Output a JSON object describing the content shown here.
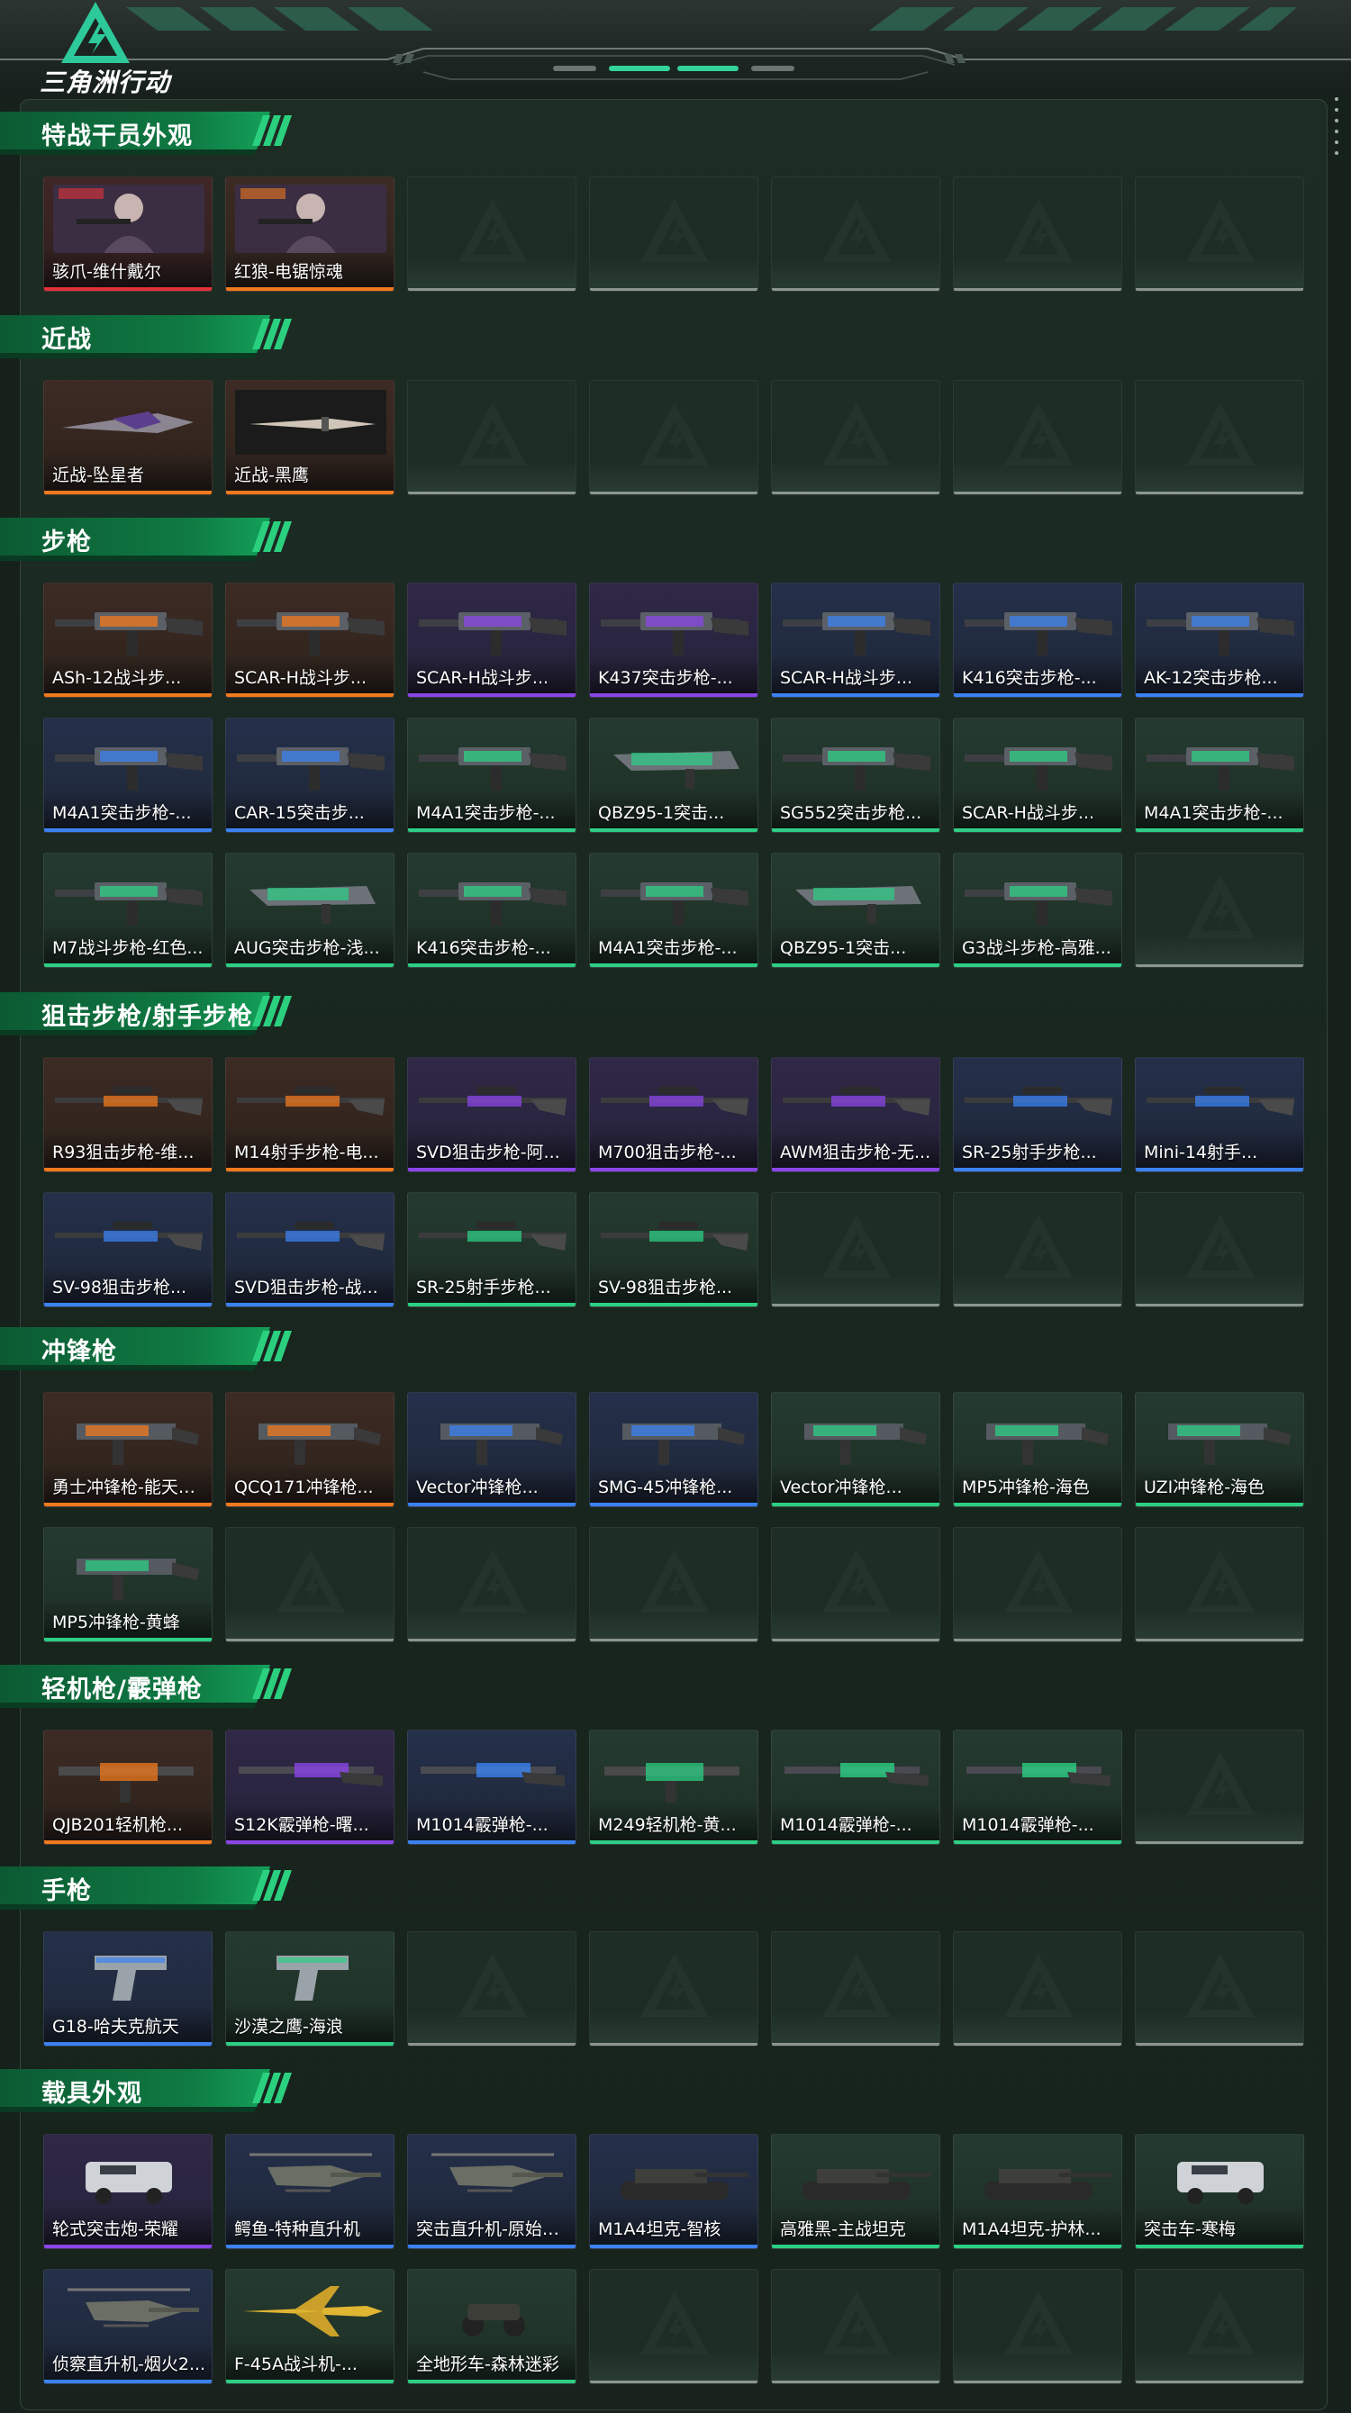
{
  "header": {
    "game_logo_text": "三角洲行动",
    "logo_icon": "delta-triangle-icon",
    "page_indicator_count": 4,
    "page_indicator_active": [
      1,
      2
    ]
  },
  "colors": {
    "orange": "#f07a1e",
    "purple": "#8a45e6",
    "blue": "#3b82f0",
    "green": "#2ccf84",
    "red": "#e2323a",
    "accent": "#33d39a"
  },
  "sections": [
    {
      "title": "特战干员外观",
      "rows": [
        [
          {
            "label": "骇爪-维什戴尔",
            "rarity": "red",
            "icon": "operator-portrait-icon"
          },
          {
            "label": "红狼-电锯惊魂",
            "rarity": "orange",
            "icon": "operator-portrait-icon"
          },
          null,
          null,
          null,
          null,
          null
        ]
      ]
    },
    {
      "title": "近战",
      "rows": [
        [
          {
            "label": "近战-坠星者",
            "rarity": "orange",
            "icon": "blade-icon"
          },
          {
            "label": "近战-黑鹰",
            "rarity": "orange",
            "icon": "knife-icon"
          },
          null,
          null,
          null,
          null,
          null
        ]
      ]
    },
    {
      "title": "步枪",
      "rows": [
        [
          {
            "label": "ASh-12战斗步...",
            "rarity": "orange",
            "icon": "rifle-icon"
          },
          {
            "label": "SCAR-H战斗步...",
            "rarity": "orange",
            "icon": "rifle-icon"
          },
          {
            "label": "SCAR-H战斗步...",
            "rarity": "purple",
            "icon": "rifle-icon"
          },
          {
            "label": "K437突击步枪-...",
            "rarity": "purple",
            "icon": "rifle-icon"
          },
          {
            "label": "SCAR-H战斗步...",
            "rarity": "blue",
            "icon": "rifle-icon"
          },
          {
            "label": "K416突击步枪-...",
            "rarity": "blue",
            "icon": "rifle-icon"
          },
          {
            "label": "AK-12突击步枪...",
            "rarity": "blue",
            "icon": "rifle-icon"
          }
        ],
        [
          {
            "label": "M4A1突击步枪-...",
            "rarity": "blue",
            "icon": "rifle-icon"
          },
          {
            "label": "CAR-15突击步...",
            "rarity": "blue",
            "icon": "rifle-icon"
          },
          {
            "label": "M4A1突击步枪-...",
            "rarity": "green",
            "icon": "rifle-icon"
          },
          {
            "label": "QBZ95-1突击...",
            "rarity": "green",
            "icon": "bullpup-rifle-icon"
          },
          {
            "label": "SG552突击步枪...",
            "rarity": "green",
            "icon": "rifle-icon"
          },
          {
            "label": "SCAR-H战斗步...",
            "rarity": "green",
            "icon": "rifle-icon"
          },
          {
            "label": "M4A1突击步枪-...",
            "rarity": "green",
            "icon": "rifle-icon"
          }
        ],
        [
          {
            "label": "M7战斗步枪-红色...",
            "rarity": "green",
            "icon": "rifle-icon"
          },
          {
            "label": "AUG突击步枪-浅...",
            "rarity": "green",
            "icon": "bullpup-rifle-icon"
          },
          {
            "label": "K416突击步枪-...",
            "rarity": "green",
            "icon": "rifle-icon"
          },
          {
            "label": "M4A1突击步枪-...",
            "rarity": "green",
            "icon": "rifle-icon"
          },
          {
            "label": "QBZ95-1突击...",
            "rarity": "green",
            "icon": "bullpup-rifle-icon"
          },
          {
            "label": "G3战斗步枪-高雅...",
            "rarity": "green",
            "icon": "rifle-icon"
          },
          null
        ]
      ]
    },
    {
      "title": "狙击步枪/射手步枪",
      "rows": [
        [
          {
            "label": "R93狙击步枪-维...",
            "rarity": "orange",
            "icon": "sniper-rifle-icon"
          },
          {
            "label": "M14射手步枪-电...",
            "rarity": "orange",
            "icon": "sniper-rifle-icon"
          },
          {
            "label": "SVD狙击步枪-阿...",
            "rarity": "purple",
            "icon": "sniper-rifle-icon"
          },
          {
            "label": "M700狙击步枪-...",
            "rarity": "purple",
            "icon": "sniper-rifle-icon"
          },
          {
            "label": "AWM狙击步枪-无...",
            "rarity": "purple",
            "icon": "sniper-rifle-icon"
          },
          {
            "label": "SR-25射手步枪...",
            "rarity": "blue",
            "icon": "sniper-rifle-icon"
          },
          {
            "label": "Mini-14射手...",
            "rarity": "blue",
            "icon": "sniper-rifle-icon"
          }
        ],
        [
          {
            "label": "SV-98狙击步枪...",
            "rarity": "blue",
            "icon": "sniper-rifle-icon"
          },
          {
            "label": "SVD狙击步枪-战...",
            "rarity": "blue",
            "icon": "sniper-rifle-icon"
          },
          {
            "label": "SR-25射手步枪...",
            "rarity": "green",
            "icon": "sniper-rifle-icon"
          },
          {
            "label": "SV-98狙击步枪...",
            "rarity": "green",
            "icon": "sniper-rifle-icon"
          },
          null,
          null,
          null
        ]
      ]
    },
    {
      "title": "冲锋枪",
      "rows": [
        [
          {
            "label": "勇士冲锋枪-能天使...",
            "rarity": "orange",
            "icon": "smg-icon"
          },
          {
            "label": "QCQ171冲锋枪...",
            "rarity": "orange",
            "icon": "smg-icon"
          },
          {
            "label": "Vector冲锋枪...",
            "rarity": "blue",
            "icon": "smg-icon"
          },
          {
            "label": "SMG-45冲锋枪...",
            "rarity": "blue",
            "icon": "smg-icon"
          },
          {
            "label": "Vector冲锋枪...",
            "rarity": "green",
            "icon": "smg-icon"
          },
          {
            "label": "MP5冲锋枪-海色",
            "rarity": "green",
            "icon": "smg-icon"
          },
          {
            "label": "UZI冲锋枪-海色",
            "rarity": "green",
            "icon": "smg-icon"
          }
        ],
        [
          {
            "label": "MP5冲锋枪-黄蜂",
            "rarity": "green",
            "icon": "smg-icon"
          },
          null,
          null,
          null,
          null,
          null,
          null
        ]
      ]
    },
    {
      "title": "轻机枪/霰弹枪",
      "rows": [
        [
          {
            "label": "QJB201轻机枪...",
            "rarity": "orange",
            "icon": "lmg-icon"
          },
          {
            "label": "S12K霰弹枪-曙...",
            "rarity": "purple",
            "icon": "shotgun-icon"
          },
          {
            "label": "M1014霰弹枪-...",
            "rarity": "blue",
            "icon": "shotgun-icon"
          },
          {
            "label": "M249轻机枪-黄...",
            "rarity": "green",
            "icon": "lmg-icon"
          },
          {
            "label": "M1014霰弹枪-...",
            "rarity": "green",
            "icon": "shotgun-icon"
          },
          {
            "label": "M1014霰弹枪-...",
            "rarity": "green",
            "icon": "shotgun-icon"
          },
          null
        ]
      ]
    },
    {
      "title": "手枪",
      "rows": [
        [
          {
            "label": "G18-哈夫克航天",
            "rarity": "blue",
            "icon": "pistol-icon"
          },
          {
            "label": "沙漠之鹰-海浪",
            "rarity": "green",
            "icon": "pistol-icon"
          },
          null,
          null,
          null,
          null,
          null
        ]
      ]
    },
    {
      "title": "载具外观",
      "rows": [
        [
          {
            "label": "轮式突击炮-荣耀",
            "rarity": "purple",
            "icon": "armored-vehicle-icon"
          },
          {
            "label": "鳄鱼-特种直升机",
            "rarity": "blue",
            "icon": "helicopter-icon"
          },
          {
            "label": "突击直升机-原始伪...",
            "rarity": "blue",
            "icon": "helicopter-icon"
          },
          {
            "label": "M1A4坦克-智核",
            "rarity": "blue",
            "icon": "tank-icon"
          },
          {
            "label": "高雅黑-主战坦克",
            "rarity": "green",
            "icon": "tank-icon"
          },
          {
            "label": "M1A4坦克-护林...",
            "rarity": "green",
            "icon": "tank-icon"
          },
          {
            "label": "突击车-寒梅",
            "rarity": "green",
            "icon": "assault-vehicle-icon"
          }
        ],
        [
          {
            "label": "侦察直升机-烟火2...",
            "rarity": "blue",
            "icon": "helicopter-icon"
          },
          {
            "label": "F-45A战斗机-...",
            "rarity": "green",
            "icon": "fighter-jet-icon"
          },
          {
            "label": "全地形车-森林迷彩",
            "rarity": "green",
            "icon": "atv-icon"
          },
          null,
          null,
          null,
          null
        ]
      ]
    }
  ]
}
